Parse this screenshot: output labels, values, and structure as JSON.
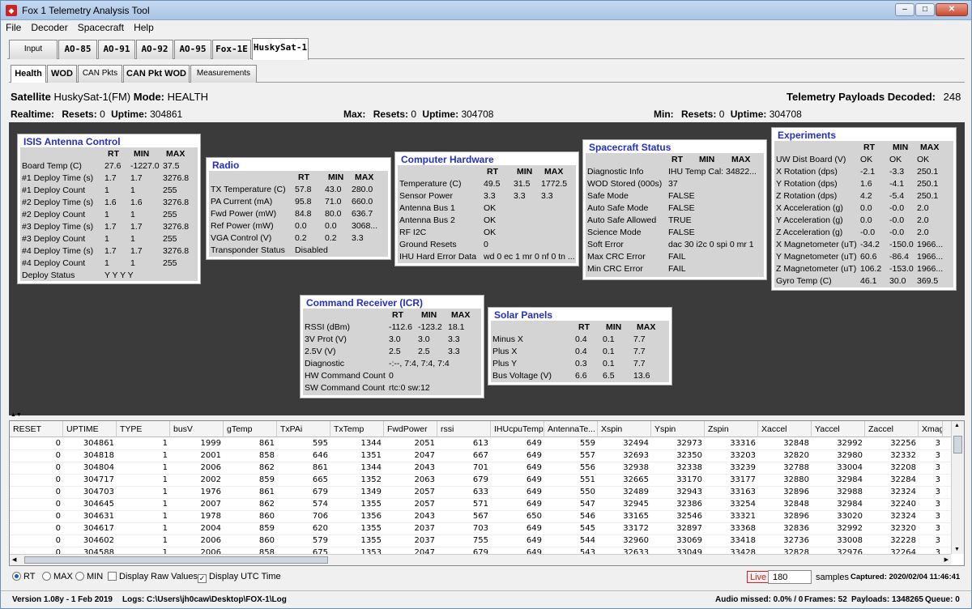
{
  "window": {
    "title": "Fox 1 Telemetry Analysis Tool",
    "min": "–",
    "max": "□",
    "close": "✕"
  },
  "menu": [
    "File",
    "Decoder",
    "Spacecraft",
    "Help"
  ],
  "spacecraft_tabs": [
    "Input",
    "AO-85",
    "AO-91",
    "AO-92",
    "AO-95",
    "Fox-1E",
    "HuskySat-1"
  ],
  "sub_tabs": [
    "Health",
    "WOD",
    "CAN Pkts",
    "CAN Pkt WOD",
    "Measurements"
  ],
  "header": {
    "satellite_label": "Satellite",
    "satellite_name": "HuskySat-1(FM)",
    "mode_label": "Mode:",
    "mode_value": "HEALTH",
    "payloads_label": "Telemetry Payloads Decoded:",
    "payloads_value": "248",
    "realtime_label": "Realtime:",
    "rt_resets_label": "Resets:",
    "rt_resets": "0",
    "rt_uptime_label": "Uptime:",
    "rt_uptime": "304861",
    "max_label": "Max:",
    "max_resets_label": "Resets:",
    "max_resets": "0",
    "max_uptime_label": "Uptime:",
    "max_uptime": "304708",
    "min_label": "Min:",
    "min_resets_label": "Resets:",
    "min_resets": "0",
    "min_uptime_label": "Uptime:",
    "min_uptime": "304708"
  },
  "col_headers": {
    "rt": "RT",
    "min": "MIN",
    "max": "MAX"
  },
  "panels": {
    "isis": {
      "title": "ISIS Antenna Control",
      "rows": [
        [
          "Board Temp (C)",
          "27.6",
          "-1227.0",
          "37.5"
        ],
        [
          "#1 Deploy Time (s)",
          "1.7",
          "1.7",
          "3276.8"
        ],
        [
          "#1 Deploy Count",
          "1",
          "1",
          "255"
        ],
        [
          "#2 Deploy Time (s)",
          "1.6",
          "1.6",
          "3276.8"
        ],
        [
          "#2 Deploy Count",
          "1",
          "1",
          "255"
        ],
        [
          "#3 Deploy Time (s)",
          "1.7",
          "1.7",
          "3276.8"
        ],
        [
          "#3 Deploy Count",
          "1",
          "1",
          "255"
        ],
        [
          "#4 Deploy Time (s)",
          "1.7",
          "1.7",
          "3276.8"
        ],
        [
          "#4 Deploy Count",
          "1",
          "1",
          "255"
        ],
        [
          "Deploy Status",
          "Y Y Y Y",
          "",
          ""
        ]
      ]
    },
    "radio": {
      "title": "Radio",
      "rows": [
        [
          "TX Temperature (C)",
          "57.8",
          "43.0",
          "280.0"
        ],
        [
          "PA Current (mA)",
          "95.8",
          "71.0",
          "660.0"
        ],
        [
          "Fwd Power (mW)",
          "84.8",
          "80.0",
          "636.7"
        ],
        [
          "Ref Power (mW)",
          "0.0",
          "0.0",
          "3068..."
        ],
        [
          "VGA Control (V)",
          "0.2",
          "0.2",
          "3.3"
        ],
        [
          "Transponder Status",
          "Disabled",
          "",
          ""
        ]
      ]
    },
    "computer": {
      "title": "Computer Hardware",
      "rows": [
        [
          "Temperature (C)",
          "49.5",
          "31.5",
          "1772.5"
        ],
        [
          "Sensor Power",
          "3.3",
          "3.3",
          "3.3"
        ],
        [
          "Antenna Bus 1",
          "OK",
          "",
          ""
        ],
        [
          "Antenna Bus 2",
          "OK",
          "",
          ""
        ],
        [
          "RF I2C",
          "OK",
          "",
          ""
        ],
        [
          "Ground Resets",
          "0",
          "",
          ""
        ],
        [
          "IHU Hard Error Data",
          "wd 0 ec 1 mr 0 nf 0 tn ...",
          "",
          ""
        ]
      ]
    },
    "spacecraft": {
      "title": "Spacecraft Status",
      "rows": [
        [
          "Diagnostic Info",
          "IHU Temp Cal: 34822...",
          "",
          ""
        ],
        [
          "WOD Stored (000s)",
          "37",
          "",
          ""
        ],
        [
          "Safe Mode",
          "FALSE",
          "",
          ""
        ],
        [
          "Auto Safe Mode",
          "FALSE",
          "",
          ""
        ],
        [
          "Auto Safe Allowed",
          "TRUE",
          "",
          ""
        ],
        [
          "Science Mode",
          "FALSE",
          "",
          ""
        ],
        [
          "Soft Error",
          "dac 30 i2c 0 spi 0 mr 1",
          "",
          ""
        ],
        [
          "Max CRC Error",
          "FAIL",
          "",
          ""
        ],
        [
          "Min CRC Error",
          "FAIL",
          "",
          ""
        ]
      ]
    },
    "experiments": {
      "title": "Experiments",
      "rows": [
        [
          "UW Dist Board (V)",
          "OK",
          "OK",
          "OK"
        ],
        [
          "X Rotation (dps)",
          "-2.1",
          "-3.3",
          "250.1"
        ],
        [
          "Y Rotation (dps)",
          "1.6",
          "-4.1",
          "250.1"
        ],
        [
          "Z Rotation (dps)",
          "4.2",
          "-5.4",
          "250.1"
        ],
        [
          "X Acceleration (g)",
          "0.0",
          "-0.0",
          "2.0"
        ],
        [
          "Y Acceleration (g)",
          "0.0",
          "-0.0",
          "2.0"
        ],
        [
          "Z Acceleration (g)",
          "-0.0",
          "-0.0",
          "2.0"
        ],
        [
          "X Magnetometer (uT)",
          "-34.2",
          "-150.0",
          "1966..."
        ],
        [
          "Y Magnetometer (uT)",
          "60.6",
          "-86.4",
          "1966..."
        ],
        [
          "Z Magnetometer (uT)",
          "106.2",
          "-153.0",
          "1966..."
        ],
        [
          "Gyro Temp (C)",
          "46.1",
          "30.0",
          "369.5"
        ]
      ]
    },
    "icr": {
      "title": "Command Receiver (ICR)",
      "rows": [
        [
          "RSSI (dBm)",
          "-112.6",
          "-123.2",
          "18.1"
        ],
        [
          "3V Prot (V)",
          "3.0",
          "3.0",
          "3.3"
        ],
        [
          "2.5V (V)",
          "2.5",
          "2.5",
          "3.3"
        ],
        [
          "Diagnostic",
          "-:--, 7:4, 7:4, 7:4",
          "",
          ""
        ],
        [
          "HW Command Count",
          "0",
          "",
          ""
        ],
        [
          "SW Command Count",
          "rtc:0 sw:12",
          "",
          ""
        ]
      ]
    },
    "solar": {
      "title": "Solar Panels",
      "rows": [
        [
          "Minus X",
          "0.4",
          "0.1",
          "7.7"
        ],
        [
          "Plus X",
          "0.4",
          "0.1",
          "7.7"
        ],
        [
          "Plus Y",
          "0.3",
          "0.1",
          "7.7"
        ],
        [
          "Bus Voltage (V)",
          "6.6",
          "6.5",
          "13.6"
        ]
      ]
    }
  },
  "table": {
    "columns": [
      "RESET",
      "UPTIME",
      "TYPE",
      "busV",
      "gTemp",
      "TxPAi",
      "TxTemp",
      "FwdPower",
      "rssi",
      "IHUcpuTemp",
      "AntennaTe...",
      "Xspin",
      "Yspin",
      "Zspin",
      "Xaccel",
      "Yaccel",
      "Zaccel",
      "Xmag"
    ],
    "rows": [
      [
        "0",
        "304861",
        "1",
        "1999",
        "861",
        "595",
        "1344",
        "2051",
        "613",
        "649",
        "559",
        "32494",
        "32973",
        "33316",
        "32848",
        "32992",
        "32256",
        "3"
      ],
      [
        "0",
        "304818",
        "1",
        "2001",
        "858",
        "646",
        "1351",
        "2047",
        "667",
        "649",
        "557",
        "32693",
        "32350",
        "33203",
        "32820",
        "32980",
        "32332",
        "3"
      ],
      [
        "0",
        "304804",
        "1",
        "2006",
        "862",
        "861",
        "1344",
        "2043",
        "701",
        "649",
        "556",
        "32938",
        "32338",
        "33239",
        "32788",
        "33004",
        "32208",
        "3"
      ],
      [
        "0",
        "304717",
        "1",
        "2002",
        "859",
        "665",
        "1352",
        "2063",
        "679",
        "649",
        "551",
        "32665",
        "33170",
        "33177",
        "32880",
        "32984",
        "32284",
        "3"
      ],
      [
        "0",
        "304703",
        "1",
        "1976",
        "861",
        "679",
        "1349",
        "2057",
        "633",
        "649",
        "550",
        "32489",
        "32943",
        "33163",
        "32896",
        "32988",
        "32324",
        "3"
      ],
      [
        "0",
        "304645",
        "1",
        "2007",
        "862",
        "574",
        "1355",
        "2057",
        "571",
        "649",
        "547",
        "32945",
        "32386",
        "33254",
        "32848",
        "32984",
        "32240",
        "3"
      ],
      [
        "0",
        "304631",
        "1",
        "1978",
        "860",
        "706",
        "1356",
        "2043",
        "567",
        "650",
        "546",
        "33165",
        "32546",
        "33321",
        "32896",
        "33020",
        "32324",
        "3"
      ],
      [
        "0",
        "304617",
        "1",
        "2004",
        "859",
        "620",
        "1355",
        "2037",
        "703",
        "649",
        "545",
        "33172",
        "32897",
        "33368",
        "32836",
        "32992",
        "32320",
        "3"
      ],
      [
        "0",
        "304602",
        "1",
        "2006",
        "860",
        "579",
        "1355",
        "2037",
        "755",
        "649",
        "544",
        "32960",
        "33069",
        "33418",
        "32736",
        "33008",
        "32228",
        "3"
      ],
      [
        "0",
        "304588",
        "1",
        "2006",
        "858",
        "675",
        "1353",
        "2047",
        "679",
        "649",
        "543",
        "32633",
        "33049",
        "33428",
        "32828",
        "32976",
        "32264",
        "3"
      ]
    ]
  },
  "controls": {
    "rt": "RT",
    "max": "MAX",
    "min": "MIN",
    "raw": "Display Raw Values",
    "utc": "Display UTC Time",
    "live": "Live",
    "samples_value": "180",
    "samples_label": "samples",
    "captured": "Captured: 2020/02/04 11:46:41"
  },
  "status": {
    "version": "Version 1.08y - 1 Feb 2019",
    "logs": "Logs: C:\\Users\\jh0caw\\Desktop\\FOX-1\\Log",
    "audio": "Audio missed: 0.0% / 0",
    "frames": "Frames: 52",
    "payloads": "Payloads: 1348265",
    "queue": "Queue: 0"
  },
  "colors": {
    "panel_title": "#2430c8",
    "dark_bg": "#3b3b3b",
    "live_red": "#cc2222"
  }
}
